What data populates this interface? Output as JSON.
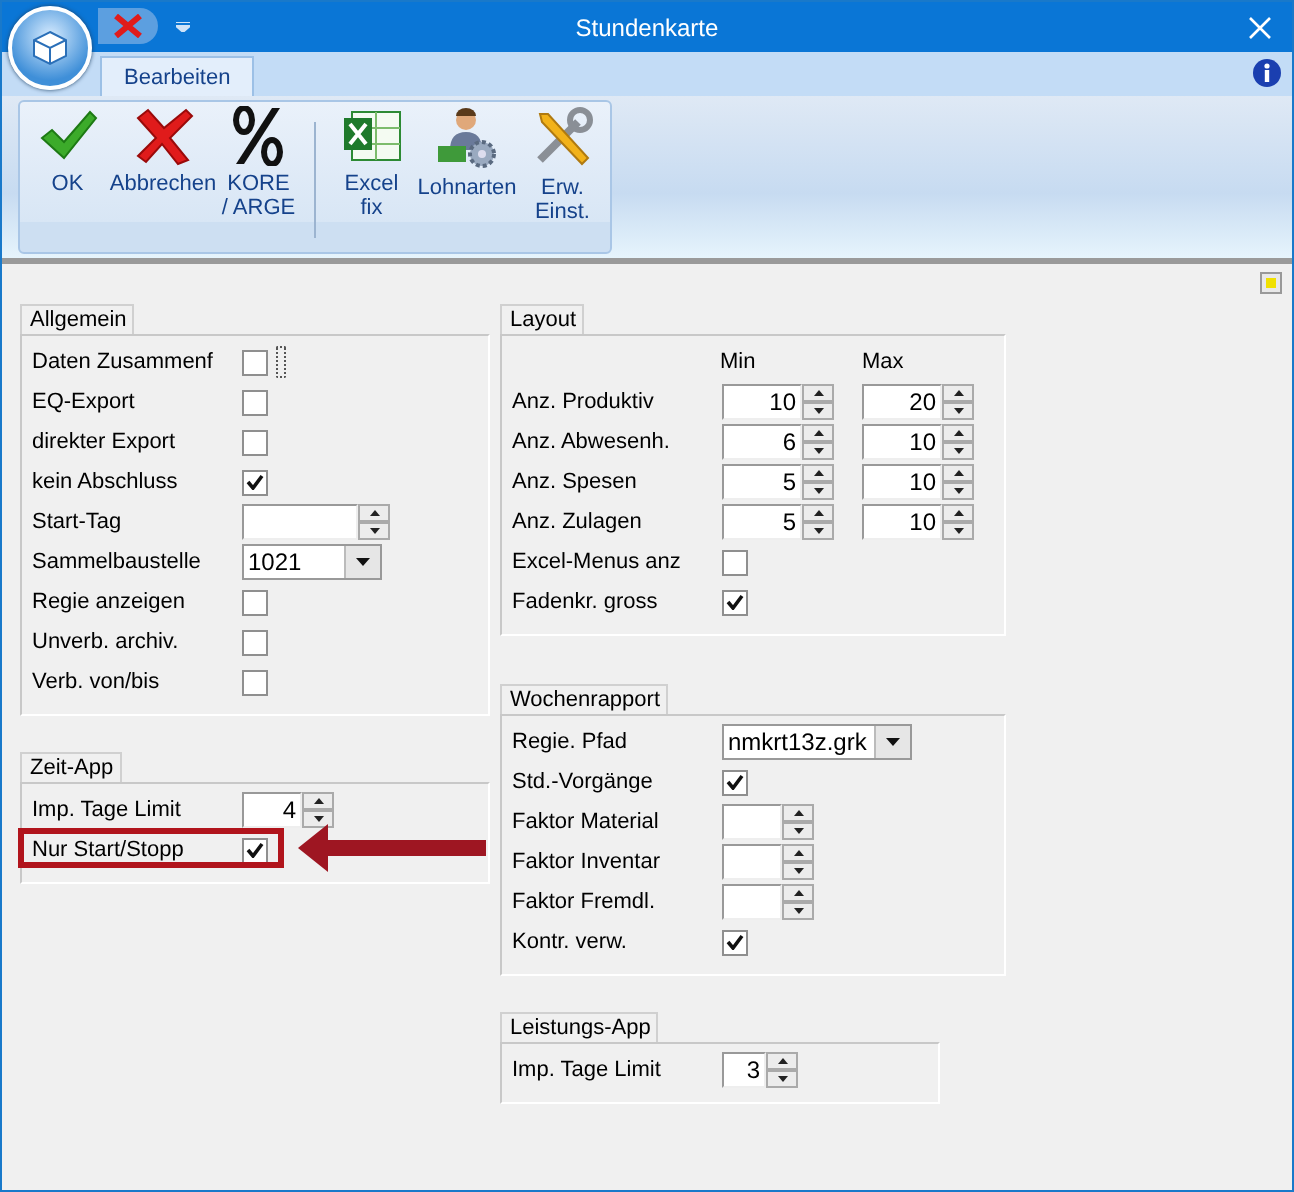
{
  "window": {
    "title": "Stundenkarte"
  },
  "tabs": [
    {
      "label": "Bearbeiten",
      "selected": true
    }
  ],
  "ribbon": {
    "groups": [
      [
        {
          "lines": [
            "OK"
          ]
        },
        {
          "lines": [
            "Abbrechen"
          ]
        },
        {
          "lines": [
            "KORE",
            "/ ARGE"
          ]
        }
      ],
      [
        {
          "lines": [
            "Excel",
            "fix"
          ]
        },
        {
          "lines": [
            "Lohnarten"
          ]
        },
        {
          "lines": [
            "Erw.",
            "Einst."
          ]
        }
      ]
    ]
  },
  "columns": [
    {
      "groups": [
        {
          "title": "Allgemein",
          "rows": [
            {
              "kind": "checkbox",
              "label": "Daten Zusammenf",
              "checked": false,
              "focused": true
            },
            {
              "kind": "checkbox",
              "label": "EQ-Export",
              "checked": false
            },
            {
              "kind": "checkbox",
              "label": "direkter Export",
              "checked": false
            },
            {
              "kind": "checkbox",
              "label": "kein Abschluss",
              "checked": true
            },
            {
              "kind": "spin",
              "label": "Start-Tag"
            },
            {
              "kind": "combo",
              "label": "Sammelbaustelle",
              "value": "1021"
            },
            {
              "kind": "checkbox",
              "label": "Regie anzeigen",
              "checked": false
            },
            {
              "kind": "checkbox",
              "label": "Unverb. archiv.",
              "checked": false
            },
            {
              "kind": "checkbox",
              "label": "Verb. von/bis",
              "checked": false
            }
          ]
        },
        {
          "title": "Zeit-App",
          "rows": [
            {
              "kind": "spin",
              "label": "Imp. Tage Limit",
              "value": "4"
            },
            {
              "kind": "checkbox",
              "label": "Nur Start/Stopp",
              "checked": true,
              "highlighted": true
            }
          ]
        }
      ]
    },
    {
      "groups": [
        {
          "title": "Layout",
          "columns": [
            "Min",
            "Max"
          ],
          "rows": [
            {
              "kind": "spin_pair",
              "label": "Anz. Produktiv",
              "min": "10",
              "max": "20"
            },
            {
              "kind": "spin_pair",
              "label": "Anz. Abwesenh.",
              "min": "6",
              "max": "10"
            },
            {
              "kind": "spin_pair",
              "label": "Anz. Spesen",
              "min": "5",
              "max": "10"
            },
            {
              "kind": "spin_pair",
              "label": "Anz. Zulagen",
              "min": "5",
              "max": "10"
            },
            {
              "kind": "checkbox",
              "label": "Excel-Menus anz",
              "checked": false
            },
            {
              "kind": "checkbox",
              "label": "Fadenkr. gross",
              "checked": true
            }
          ]
        },
        {
          "title": "Wochenrapport",
          "rows": [
            {
              "kind": "combo",
              "label": "Regie. Pfad",
              "value": "nmkrt13z.grk"
            },
            {
              "kind": "checkbox",
              "label": "Std.-Vorgänge",
              "checked": true
            },
            {
              "kind": "spin",
              "label": "Faktor Material"
            },
            {
              "kind": "spin",
              "label": "Faktor Inventar"
            },
            {
              "kind": "spin",
              "label": "Faktor Fremdl."
            },
            {
              "kind": "checkbox",
              "label": "Kontr. verw.",
              "checked": true
            }
          ]
        },
        {
          "title": "Leistungs-App",
          "rows": [
            {
              "kind": "spin",
              "label": "Imp. Tage Limit",
              "value": "3"
            }
          ]
        }
      ]
    }
  ]
}
